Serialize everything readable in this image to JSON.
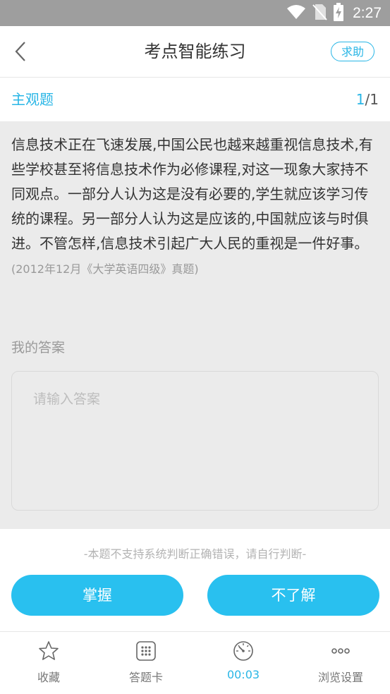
{
  "status_bar": {
    "time": "2:27"
  },
  "nav": {
    "title": "考点智能练习",
    "help_label": "求助"
  },
  "question_header": {
    "type": "主观题",
    "current": "1",
    "total": "/1"
  },
  "question": {
    "text": "信息技术正在飞速发展,中国公民也越来越重视信息技术,有些学校甚至将信息技术作为必修课程,对这一现象大家持不同观点。一部分人认为这是没有必要的,学生就应该学习传统的课程。另一部分人认为这是应该的,中国就应该与时俱进。不管怎样,信息技术引起广大人民的重视是一件好事。",
    "source": "(2012年12月《大学英语四级》真题)"
  },
  "answer": {
    "label": "我的答案",
    "placeholder": "请输入答案",
    "value": ""
  },
  "actions": {
    "note": "-本题不支持系统判断正确错误，请自行判断-",
    "master_label": "掌握",
    "unknown_label": "不了解"
  },
  "bottom_tabs": [
    {
      "label": "收藏",
      "icon": "star-icon"
    },
    {
      "label": "答题卡",
      "icon": "grid-icon"
    },
    {
      "label": "00:03",
      "icon": "timer-icon"
    },
    {
      "label": "浏览设置",
      "icon": "more-icon"
    }
  ],
  "colors": {
    "accent": "#29b6e6",
    "button": "#29c0ef",
    "status_bar": "#9e9e9e"
  }
}
